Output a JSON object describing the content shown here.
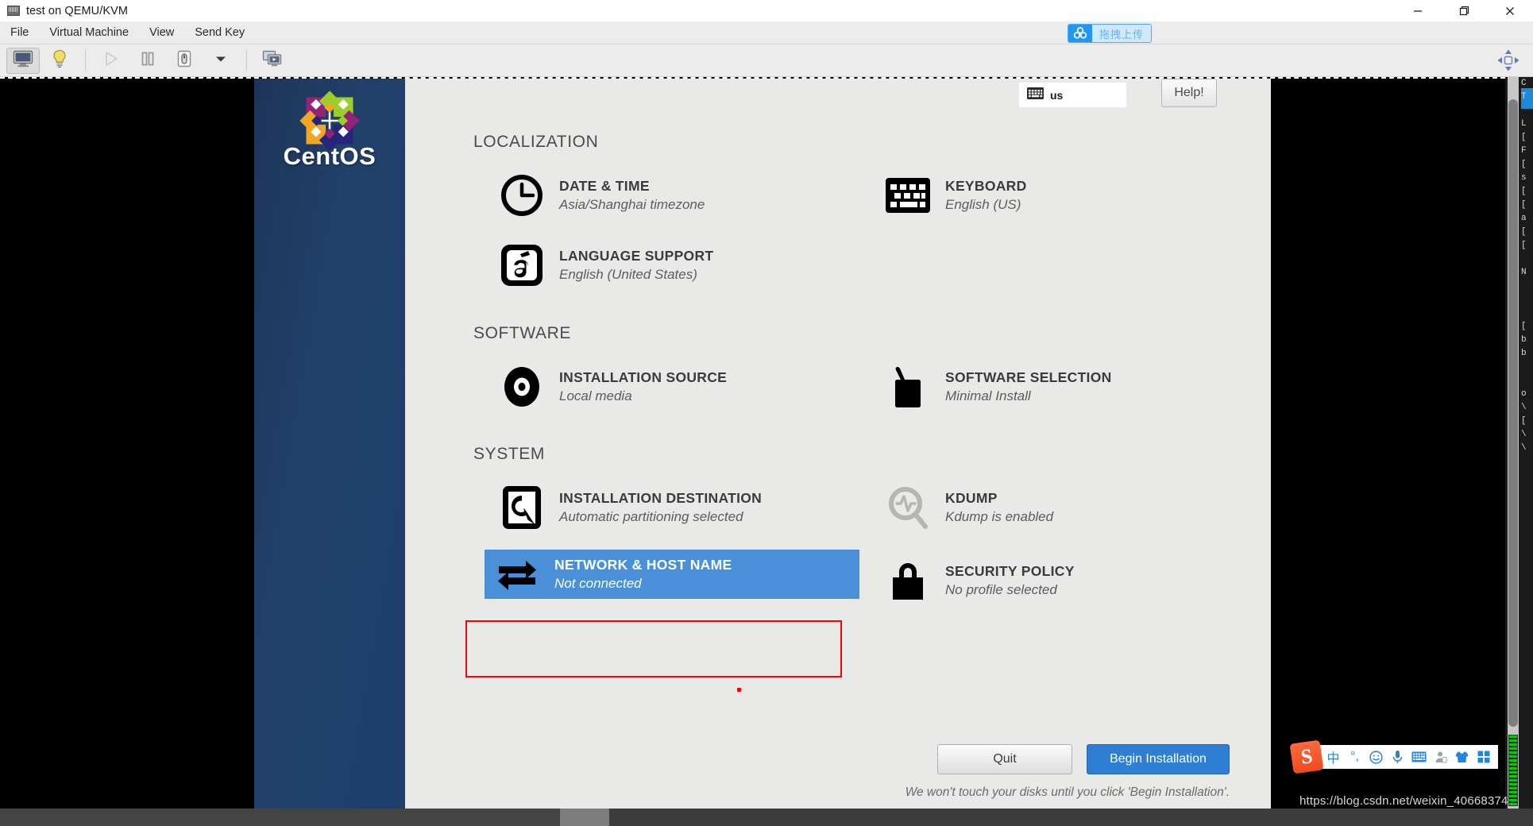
{
  "window": {
    "title": "test on QEMU/KVM",
    "icon": "vm-icon",
    "controls": [
      {
        "name": "minimize-button",
        "glyph": "minimize-icon"
      },
      {
        "name": "maximize-button",
        "glyph": "maximize-icon"
      },
      {
        "name": "close-button",
        "glyph": "close-icon"
      }
    ]
  },
  "menubar": {
    "items": [
      {
        "label": "File",
        "name": "menu-file"
      },
      {
        "label": "Virtual Machine",
        "name": "menu-virtual-machine"
      },
      {
        "label": "View",
        "name": "menu-view"
      },
      {
        "label": "Send Key",
        "name": "menu-send-key"
      }
    ],
    "upload_button": {
      "label": "拖拽上传",
      "icon": "cloud-upload-icon",
      "accent": "#2196f3"
    }
  },
  "toolbar": {
    "buttons": [
      {
        "name": "show-console-button",
        "icon": "monitor-icon",
        "state": "active"
      },
      {
        "name": "show-details-button",
        "icon": "lightbulb-icon",
        "state": "normal"
      },
      {
        "name": "run-button",
        "icon": "play-icon",
        "state": "disabled"
      },
      {
        "name": "pause-button",
        "icon": "pause-icon",
        "state": "normal"
      },
      {
        "name": "shutdown-button",
        "icon": "power-icon",
        "state": "normal"
      },
      {
        "name": "shutdown-menu-button",
        "icon": "chevron-down-icon",
        "state": "normal"
      },
      {
        "name": "snapshots-button",
        "icon": "screens-icon",
        "state": "normal"
      }
    ],
    "right_button": {
      "name": "fullscreen-resize-button",
      "icon": "move-resize-icon"
    }
  },
  "anaconda": {
    "brand": {
      "logo": "centos-logo",
      "name": "CentOS"
    },
    "keyboard_indicator": {
      "icon": "keyboard-icon",
      "label": "us"
    },
    "help_button": "Help!",
    "sections": [
      {
        "name": "localization",
        "title": "LOCALIZATION",
        "items": [
          {
            "name": "date-and-time",
            "icon": "clock-icon",
            "title": "DATE & TIME",
            "sub": "Asia/Shanghai timezone",
            "column": "left",
            "state": "normal"
          },
          {
            "name": "keyboard",
            "icon": "keyboard-icon",
            "title": "KEYBOARD",
            "sub": "English (US)",
            "column": "right",
            "state": "normal"
          },
          {
            "name": "language-support",
            "icon": "language-a-acute-icon",
            "title": "LANGUAGE SUPPORT",
            "sub": "English (United States)",
            "column": "left",
            "state": "normal"
          }
        ]
      },
      {
        "name": "software",
        "title": "SOFTWARE",
        "items": [
          {
            "name": "installation-source",
            "icon": "disc-icon",
            "title": "INSTALLATION SOURCE",
            "sub": "Local media",
            "column": "left",
            "state": "normal"
          },
          {
            "name": "software-selection",
            "icon": "package-icon",
            "title": "SOFTWARE SELECTION",
            "sub": "Minimal Install",
            "column": "right",
            "state": "normal"
          }
        ]
      },
      {
        "name": "system",
        "title": "SYSTEM",
        "items": [
          {
            "name": "installation-destination",
            "icon": "harddrive-icon",
            "title": "INSTALLATION DESTINATION",
            "sub": "Automatic partitioning selected",
            "column": "left",
            "state": "normal"
          },
          {
            "name": "kdump",
            "icon": "magnifier-pulse-icon",
            "title": "KDUMP",
            "sub": "Kdump is enabled",
            "column": "right",
            "state": "dim"
          },
          {
            "name": "network-and-host-name",
            "icon": "network-arrows-icon",
            "title": "NETWORK & HOST NAME",
            "sub": "Not connected",
            "column": "left",
            "state": "selected"
          },
          {
            "name": "security-policy",
            "icon": "lock-icon",
            "title": "SECURITY POLICY",
            "sub": "No profile selected",
            "column": "right",
            "state": "normal"
          }
        ]
      }
    ],
    "footer": {
      "quit_label": "Quit",
      "begin_label": "Begin Installation",
      "disclaimer": "We won't touch your disks until you click 'Begin Installation'."
    },
    "annotation": {
      "highlight_color": "#ff0000",
      "highlight_target": "network-and-host-name"
    }
  },
  "overlays": {
    "ime": {
      "name": "sogou-ime-toolbar",
      "logo_glyph": "S",
      "icons": [
        {
          "name": "chinese-mode-icon",
          "glyph": "中"
        },
        {
          "name": "punctuation-mode-icon",
          "glyph": "°,"
        },
        {
          "name": "emoji-icon",
          "glyph": "☺"
        },
        {
          "name": "voice-input-icon",
          "glyph": "🎤"
        },
        {
          "name": "soft-keyboard-icon",
          "glyph": "⌨"
        },
        {
          "name": "user-account-icon",
          "glyph": "👤"
        },
        {
          "name": "skin-icon",
          "glyph": "👕"
        },
        {
          "name": "toolbox-icon",
          "glyph": "▦"
        }
      ]
    },
    "watermark": "https://blog.csdn.net/weixin_40668374"
  },
  "colors": {
    "selection_blue": "#4a90d9",
    "primary_button": "#2e7fd4",
    "sidebar_navy": "#1d3557",
    "annotation_red": "#ff0000"
  }
}
